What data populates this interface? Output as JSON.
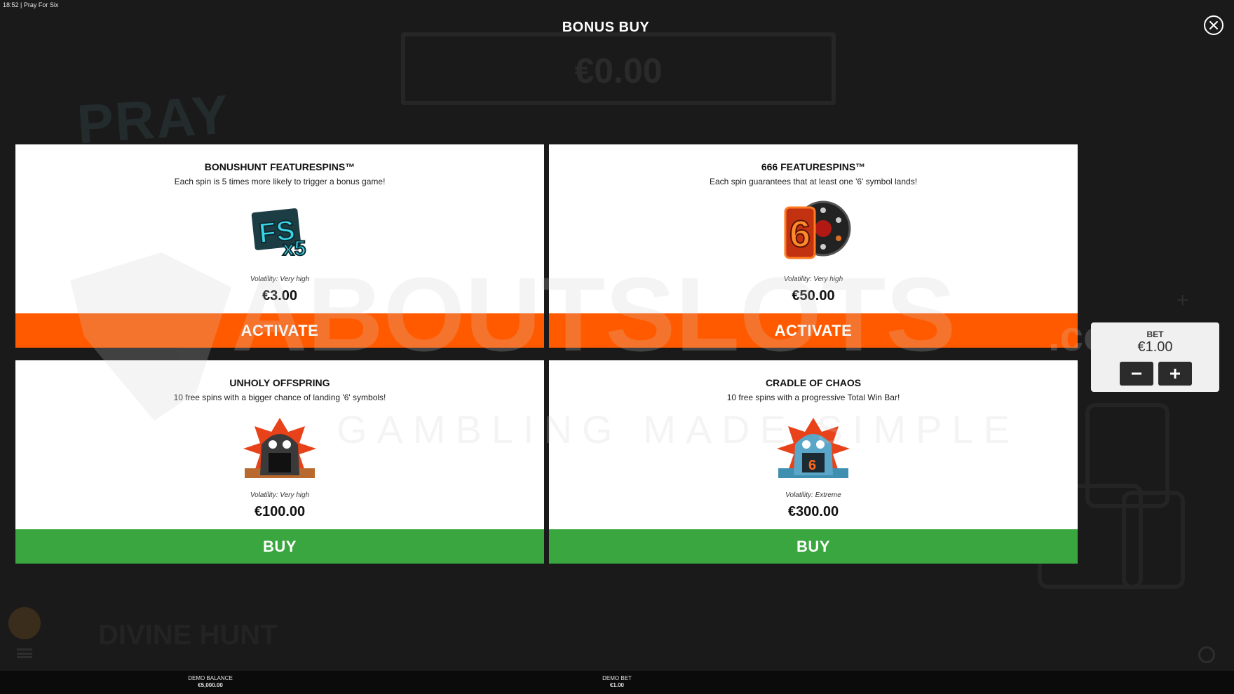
{
  "status_bar": {
    "time": "18:52",
    "separator": "|",
    "app_title": "Pray For Six"
  },
  "background": {
    "amount": "€0.00",
    "logo": "PRAY",
    "bottom_logo": "DIVINE HUNT"
  },
  "modal": {
    "title": "BONUS BUY",
    "close_icon": "close-icon"
  },
  "cards": [
    {
      "title": "BONUSHUNT FEATURESPINS™",
      "description": "Each spin is 5 times more likely to trigger a bonus game!",
      "icon": "fs-x5-icon",
      "volatility": "Volatility: Very high",
      "price": "€3.00",
      "action": "ACTIVATE"
    },
    {
      "title": "666 FEATURESPINS™",
      "description": "Each spin guarantees that at least one '6' symbol lands!",
      "icon": "six-wheel-icon",
      "volatility": "Volatility: Very high",
      "price": "€50.00",
      "action": "ACTIVATE"
    },
    {
      "title": "UNHOLY OFFSPRING",
      "description": "10 free spins with a bigger chance of landing '6' symbols!",
      "icon": "unholy-skull-icon",
      "volatility": "Volatility: Very high",
      "price": "€100.00",
      "action": "BUY"
    },
    {
      "title": "CRADLE OF CHAOS",
      "description": "10 free spins with a progressive Total Win Bar!",
      "icon": "chaos-skull-icon",
      "volatility": "Volatility: Extreme",
      "price": "€300.00",
      "action": "BUY"
    }
  ],
  "bet_panel": {
    "label": "BET",
    "value": "€1.00",
    "minus_icon": "minus-icon",
    "plus_icon": "plus-icon"
  },
  "bottom_bar": {
    "balance_label": "DEMO BALANCE",
    "balance_value": "€5,000.00",
    "bet_label": "DEMO BET",
    "bet_value": "€1.00"
  },
  "watermark": {
    "brand": "ABOUTSLOTS",
    "suffix": ".com",
    "tagline": "GAMBLING MADE SIMPLE"
  },
  "colors": {
    "activate": "#ff5a00",
    "buy": "#3aa63f",
    "background": "#1a1a1a",
    "card": "#ffffff"
  }
}
